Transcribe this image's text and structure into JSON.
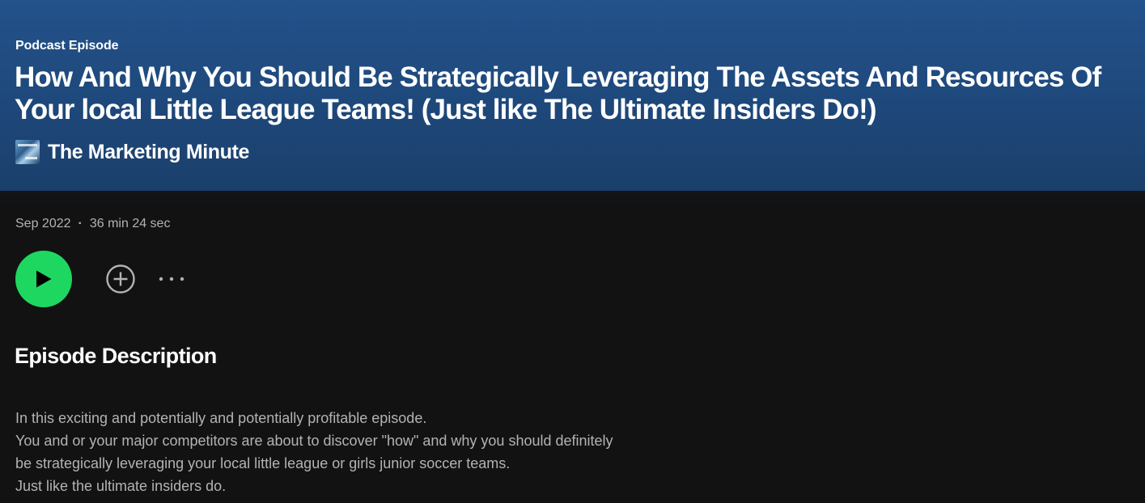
{
  "episode": {
    "type_label": "Podcast Episode",
    "title": "How And Why You Should Be Strategically Leveraging The Assets And Resources Of Your local Little League Teams! (Just like The Ultimate Insiders Do!)",
    "show_name": "The Marketing Minute",
    "date": "Sep 2022",
    "separator": "·",
    "duration": "36 min 24 sec"
  },
  "controls": {
    "play_icon": "play-icon",
    "add_icon": "plus-circle-icon",
    "more_icon": "more-horizontal-icon",
    "play_color": "#1ed760"
  },
  "description_section": {
    "heading": "Episode Description",
    "lines": [
      "In this exciting and potentially and potentially profitable episode.",
      "You and or your major competitors are about to discover \"how\" and why you should definitely",
      "be strategically leveraging your local little league or girls junior soccer teams.",
      "Just like the ultimate insiders do."
    ]
  },
  "colors": {
    "header_gradient_top": "#23518a",
    "header_gradient_bottom": "#1a3f6b",
    "background": "#121212",
    "muted_text": "#b3b3b3"
  }
}
